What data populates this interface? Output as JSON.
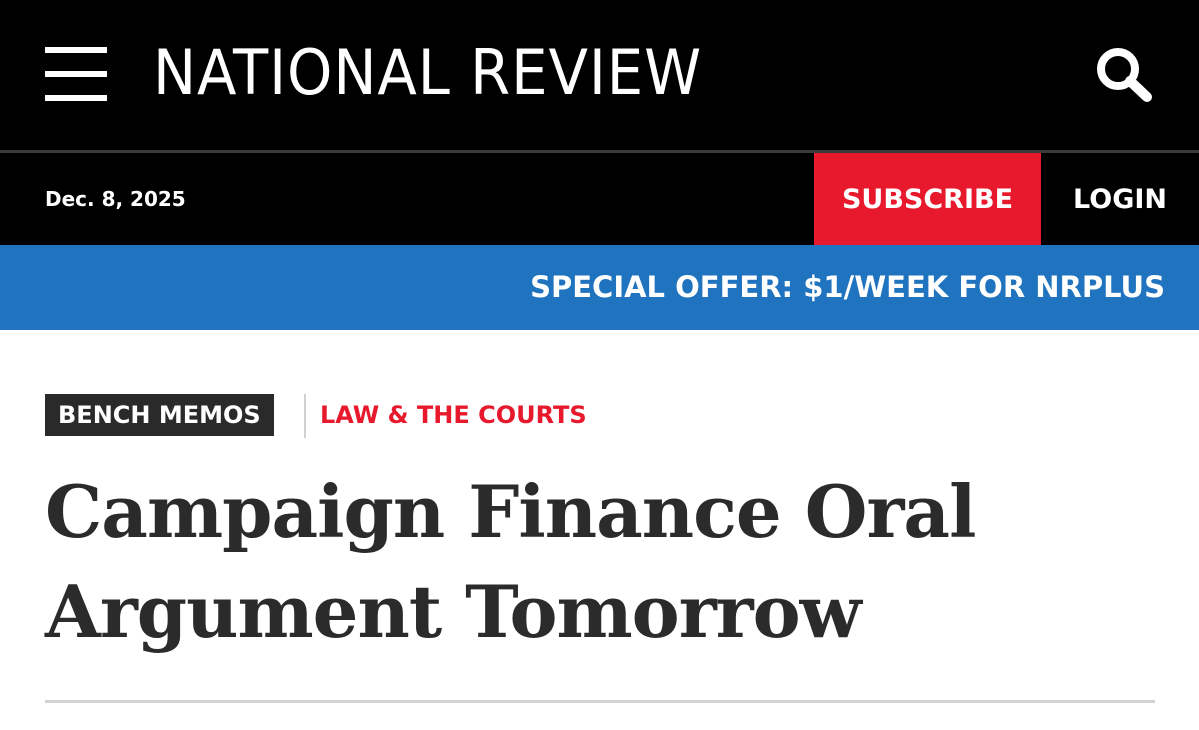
{
  "header": {
    "logo_text": "NATIONAL REVIEW",
    "menu_icon": "hamburger-menu-icon",
    "search_icon": "search-icon"
  },
  "subheader": {
    "date": "Dec. 8, 2025",
    "subscribe_label": "SUBSCRIBE",
    "login_label": "LOGIN",
    "subscribe_color": "#e8192c"
  },
  "offer": {
    "text": "SPECIAL OFFER: $1/WEEK FOR NRPLUS",
    "color": "#1f73bf"
  },
  "article": {
    "blog_tag": "BENCH MEMOS",
    "topic_tag": "LAW & THE COURTS",
    "title": "Campaign Finance Oral Argument Tomorrow"
  }
}
